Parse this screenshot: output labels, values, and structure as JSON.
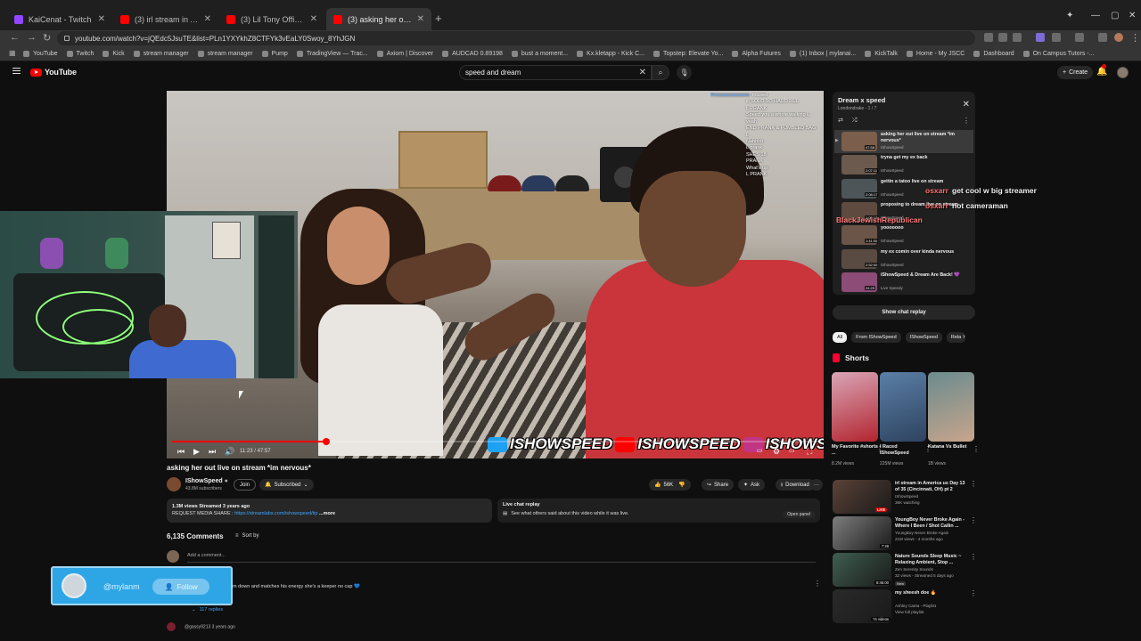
{
  "browser": {
    "tabs": [
      {
        "label": "KaiCenat - Twitch",
        "kind": "twitch"
      },
      {
        "label": "(3) irl stream in America us Da",
        "kind": "yt"
      },
      {
        "label": "(3) Lil Tony Official x Nino",
        "kind": "yt"
      },
      {
        "label": "(3) asking her out live on stre",
        "kind": "yt"
      }
    ],
    "url": "youtube.com/watch?v=jQEdc5JsuTE&list=PLn1YXYkhZ8CTFYk3vEaLY0Swoy_8YhJGN",
    "bookmarks": [
      "YouTube",
      "Twitch",
      "Kick",
      "stream manager",
      "stream manager",
      "Pump",
      "TradingView — Trac...",
      "Axiom | Discover",
      "AUDCAD 0.89198",
      "bust a moment...",
      "Kx.kletapp - Kick C...",
      "Topstep: Elevate Yo...",
      "Alpha Futures",
      "(1) Inbox | mylanai...",
      "KickTalk",
      "Home - My JSCC",
      "Dashboard",
      "On Campus Tutors -..."
    ]
  },
  "youtube": {
    "logo": "YouTube",
    "search_value": "speed and dream",
    "create_label": "Create"
  },
  "video": {
    "title": "asking her out live on stream *im nervous*",
    "time": "11:23 / 47:57",
    "progress": 0.239,
    "brand": [
      "ISHOWSPEED",
      "ISHOWSPEED",
      "ISHOWSPEED"
    ],
    "chat_overlay": [
      {
        "u": "Reaaaaaaaaaaaa",
        "m": "missed"
      },
      {
        "u": "",
        "m": "ill SOLD SO HARD REL"
      },
      {
        "u": "",
        "m": "L PRANK"
      },
      {
        "u": "",
        "m": "Speed you a whole walking L"
      },
      {
        "u": "",
        "m": "yeah"
      },
      {
        "u": "",
        "m": "END PRANK & FUMBLED BAG"
      },
      {
        "u": "",
        "m": "L"
      },
      {
        "u": "",
        "m": "Nahhhh"
      },
      {
        "u": "",
        "m": "L prank"
      },
      {
        "u": "",
        "m": "SHES 18"
      },
      {
        "u": "",
        "m": "PRANK"
      },
      {
        "u": "",
        "m": "What's up"
      },
      {
        "u": "",
        "m": "L PRANK"
      }
    ]
  },
  "channel": {
    "name": "IShowSpeed",
    "subs": "43.8M subscribers",
    "join": "Join",
    "subscribed": "Subscribed",
    "likes": "56K",
    "share": "Share",
    "ask": "Ask",
    "download": "Download"
  },
  "description": {
    "stats": "1.3M views  Streamed 3 years ago",
    "line2_label": "REQUEST MEDIA SHARE : ",
    "line2_link": "https://streamlabs.com/ishowspeed/tip",
    "more": "...more"
  },
  "live_chat_replay": {
    "title": "Live chat replay",
    "text": "See what others said about this video while it was live.",
    "button": "Open panel"
  },
  "comments": {
    "count": "6,135 Comments",
    "sort": "Sort by",
    "add_placeholder": "Add a comment...",
    "c1": "am down and matches his energy she's a keeper no cap",
    "replies": "117 replies",
    "c2_user": "@gassy9213 3 years ago"
  },
  "follow_card": {
    "handle": "@mylanm",
    "button": "Follow"
  },
  "playlist": {
    "title": "Dream x speed",
    "sub": "Londondrake - 1 / 7",
    "items": [
      {
        "title": "asking her out live on stream *im nervous*",
        "channel": "IShowSpeed",
        "dur": "47:58",
        "color": "#7b5e4b"
      },
      {
        "title": "tryna get my ex back",
        "channel": "IShowSpeed",
        "dur": "2:07:11",
        "color": "#6b5a4d"
      },
      {
        "title": "gettin a tatoo live on stream",
        "channel": "IShowSpeed",
        "dur": "2:08:17",
        "color": "#4d5559"
      },
      {
        "title": "proposing to dream live on stream",
        "channel": "IShowSpeed",
        "dur": "1:00:12",
        "color": "#5f4a3f"
      },
      {
        "title": "yooooooo",
        "channel": "IShowSpeed",
        "dur": "1:41:00",
        "color": "#6a5548"
      },
      {
        "title": "my ex comin over kinda nervous",
        "channel": "IShowSpeed",
        "dur": "2:52:00",
        "color": "#594b42"
      },
      {
        "title": "iShowSpeed & Dream Are Back! 💜",
        "channel": "Live Speedy",
        "dur": "24:29",
        "color": "#8c4c77"
      }
    ]
  },
  "twitch_overlay": [
    {
      "u": "osxarr",
      "m": "get cool w big streamer"
    },
    {
      "u": "osxarr",
      "m": "not cameraman"
    },
    {
      "u": "BlackJewishRepublican",
      "m": ""
    }
  ],
  "show_chat": "Show chat replay",
  "chips": [
    "All",
    "From IShowSpeed",
    "IShowSpeed",
    "Rela"
  ],
  "shorts": {
    "heading": "Shorts",
    "items": [
      {
        "title": "My Favorite #shorts ...",
        "views": "8.2M views",
        "c1": "#d9a6b6",
        "c2": "#b3242f"
      },
      {
        "title": "I Raced IShowSpeed",
        "views": "225M views",
        "c1": "#5a7fa6",
        "c2": "#2e4360"
      },
      {
        "title": "Katana Vs Bullet",
        "views": "1B views",
        "c1": "#6b8b8f",
        "c2": "#c7a58b"
      }
    ]
  },
  "recommendations": [
    {
      "title": "irl stream in America us Day 13 of 35 (Cincinnati, OH) pt 2",
      "channel": "IShowSpeed",
      "meta": "36K watching",
      "badge": "LIVE",
      "color": "#5b4237"
    },
    {
      "title": "YoungBoy Never Broke Again - Where I Been / Shot Callin ...",
      "channel": "YoungBoy Never Broke Again",
      "meta": "21M views - 4 months ago",
      "dur": "7:28",
      "color": "#7e7e7e"
    },
    {
      "title": "Nature Sounds Sleep Music ~ Relaxing Ambient, Stop ...",
      "channel": "Zen Serenity Sounds",
      "meta": "32 views - Streamed 5 days ago",
      "tag": "New",
      "dur": "8:45:00",
      "color": "#3f5e50"
    },
    {
      "title": "my sheesh doe 🔥",
      "channel": "Ashley Caeta - Playlist",
      "meta": "View full playlist",
      "dur": "74 videos",
      "color": "#2a2a2a"
    }
  ],
  "colors": {
    "accent": "#ff0000",
    "link": "#3ea6ff",
    "follow_card": "#2ea6e6"
  }
}
